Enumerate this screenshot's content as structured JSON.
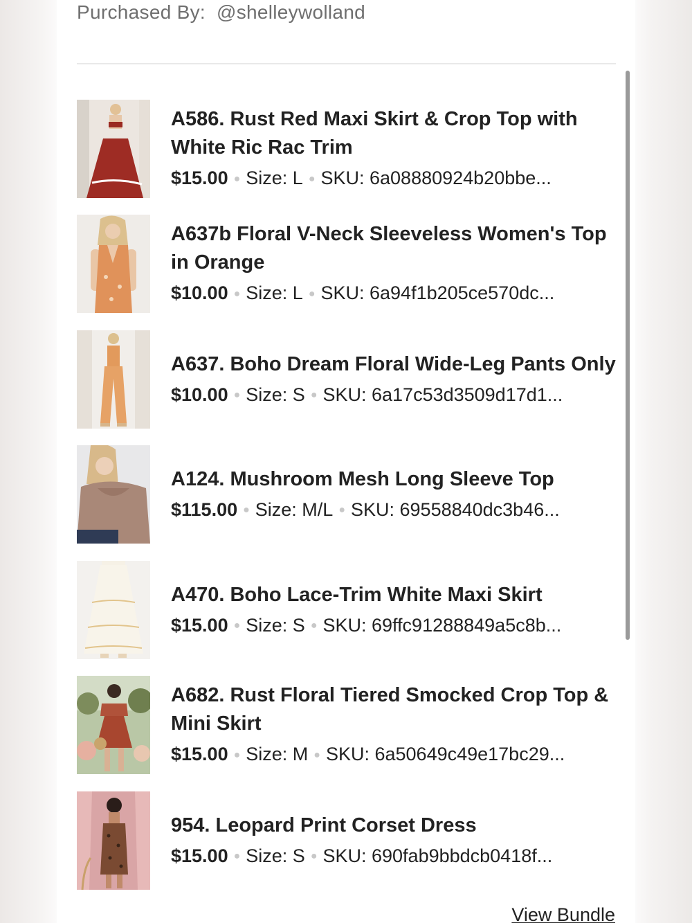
{
  "header": {
    "purchased_label": "Purchased By:",
    "purchased_user": "@shelleywolland"
  },
  "items": [
    {
      "title": "A586. Rust Red Maxi Skirt & Crop Top with White Ric Rac Trim",
      "price": "$15.00",
      "size": "Size: L",
      "sku": "SKU: 6a08880924b20bbe..."
    },
    {
      "title": "A637b Floral V-Neck Sleeveless Women's Top in Orange",
      "price": "$10.00",
      "size": "Size: L",
      "sku": "SKU: 6a94f1b205ce570dc..."
    },
    {
      "title": "A637. Boho Dream Floral Wide-Leg Pants Only",
      "price": "$10.00",
      "size": "Size: S",
      "sku": "SKU: 6a17c53d3509d17d1..."
    },
    {
      "title": "A124. Mushroom Mesh Long Sleeve Top",
      "price": "$115.00",
      "size": "Size: M/L",
      "sku": "SKU: 69558840dc3b46..."
    },
    {
      "title": "A470. Boho Lace-Trim White Maxi Skirt",
      "price": "$15.00",
      "size": "Size: S",
      "sku": "SKU: 69ffc91288849a5c8b..."
    },
    {
      "title": "A682. Rust Floral Tiered Smocked Crop Top & Mini Skirt",
      "price": "$15.00",
      "size": "Size: M",
      "sku": "SKU: 6a50649c49e17bc29..."
    },
    {
      "title": "954. Leopard Print Corset Dress",
      "price": "$15.00",
      "size": "Size: S",
      "sku": "SKU: 690fab9bbdcb0418f..."
    }
  ],
  "footer": {
    "view_bundle_label": "View Bundle"
  },
  "colors": {
    "text": "#222222",
    "muted": "#6f6f6f",
    "divider": "#e9e9e9"
  }
}
